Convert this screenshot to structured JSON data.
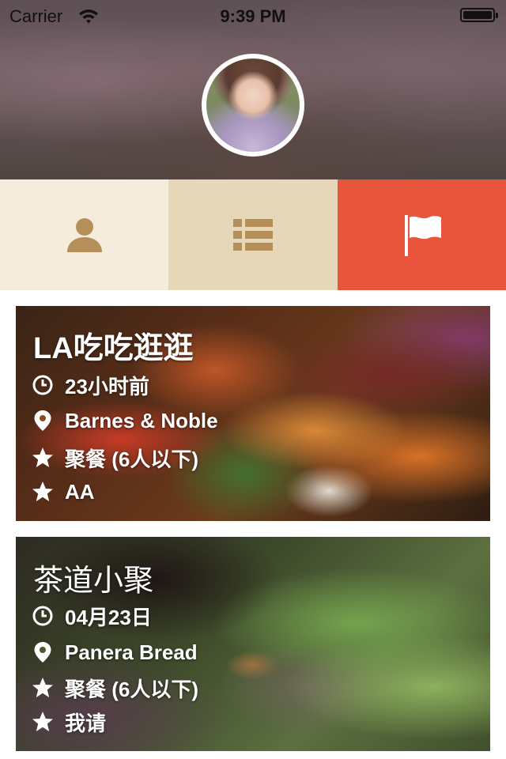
{
  "status_bar": {
    "carrier": "Carrier",
    "time": "9:39 PM"
  },
  "header": {
    "avatar_icon": "user-avatar-photo"
  },
  "tabs": [
    {
      "icon": "person-icon",
      "active": false,
      "color": "#f5ecdc",
      "icon_color": "#b48f59"
    },
    {
      "icon": "list-icon",
      "active": false,
      "color": "#e6d7b9",
      "icon_color": "#b48f59"
    },
    {
      "icon": "flag-icon",
      "active": true,
      "color": "#e9543d",
      "icon_color": "#ffffff"
    }
  ],
  "events": [
    {
      "title": "LA吃吃逛逛",
      "time": "23小时前",
      "location": "Barnes & Noble",
      "type": "聚餐 (6人以下)",
      "payment": "AA"
    },
    {
      "title": "茶道小聚",
      "time": "04月23日",
      "location": "Panera Bread",
      "type": "聚餐 (6人以下)",
      "payment": "我请"
    }
  ]
}
